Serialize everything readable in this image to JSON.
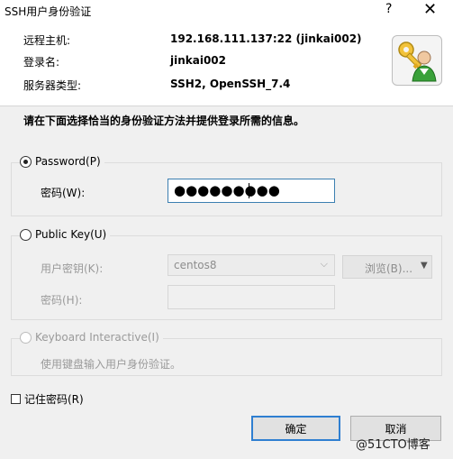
{
  "window": {
    "title": "SSH用户身份验证",
    "help_label": "?",
    "close_label": "✕"
  },
  "info": {
    "host_label": "远程主机:",
    "host_value": "192.168.111.137:22 (jinkai002)",
    "login_label": "登录名:",
    "login_value": "jinkai002",
    "server_type_label": "服务器类型:",
    "server_type_value": "SSH2, OpenSSH_7.4",
    "avatar_icon": "key-user-icon"
  },
  "instruction": "请在下面选择恰当的身份验证方法并提供登录所需的信息。",
  "password_group": {
    "label": "Password(P)",
    "selected": true,
    "field_label": "密码(W):",
    "value_masked": "●●●●●●●●●"
  },
  "publickey_group": {
    "label": "Public Key(U)",
    "selected": false,
    "user_key_label": "用户密钥(K):",
    "user_key_value": "centos8",
    "browse_label": "浏览(B)...",
    "passphrase_label": "密码(H):"
  },
  "keyboard_group": {
    "label": "Keyboard Interactive(I)",
    "selected": false,
    "description": "使用键盘输入用户身份验证。"
  },
  "remember": {
    "label": "记住密码(R)",
    "checked": false
  },
  "buttons": {
    "ok": "确定",
    "cancel": "取消"
  },
  "watermark": "@51CTO博客",
  "colors": {
    "background": "#f0f0f0",
    "focus_border": "#3c7fb1",
    "primary_button_border": "#2f7fd1"
  }
}
